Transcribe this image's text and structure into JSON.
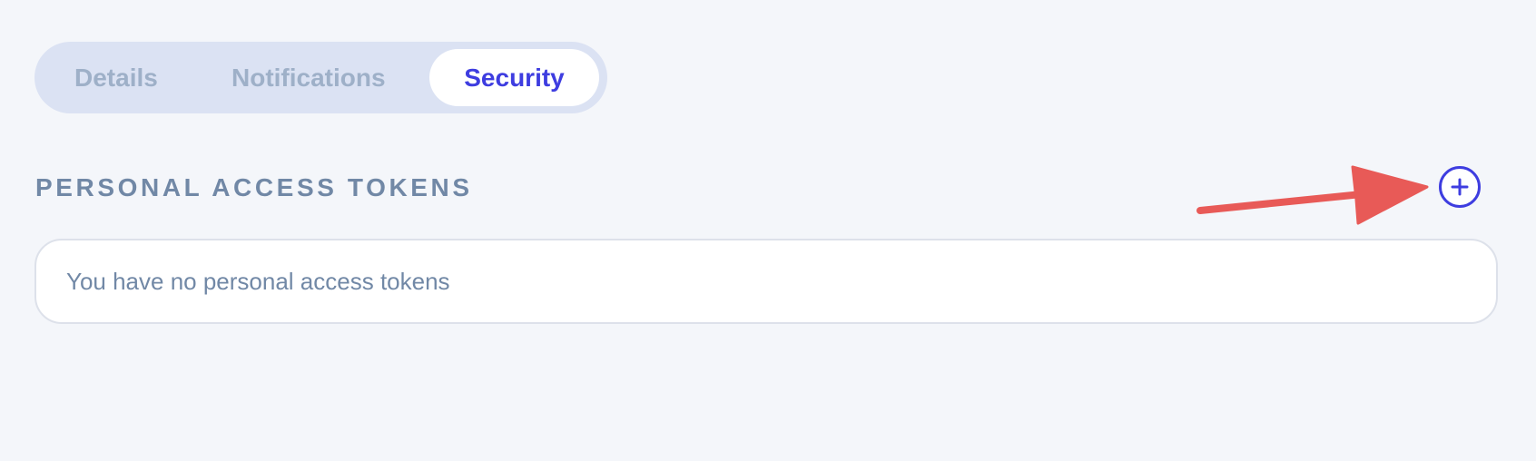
{
  "tabs": {
    "items": [
      {
        "label": "Details",
        "active": false
      },
      {
        "label": "Notifications",
        "active": false
      },
      {
        "label": "Security",
        "active": true
      }
    ]
  },
  "section": {
    "title": "PERSONAL ACCESS TOKENS",
    "add_button": {
      "icon": "plus-circle-icon"
    },
    "empty_message": "You have no personal access tokens"
  },
  "annotation": {
    "icon": "arrow-right-icon",
    "color": "#e85a57"
  },
  "colors": {
    "accent": "#3e3de0",
    "muted_text": "#7188a6",
    "inactive_tab": "#9eb0c8",
    "tab_bar_bg": "#dbe2f3",
    "page_bg": "#f4f6fa"
  }
}
